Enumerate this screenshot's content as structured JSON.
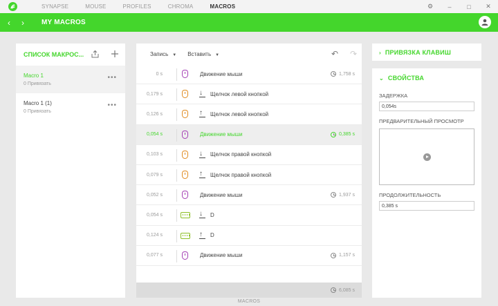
{
  "topbar": {
    "tabs": [
      "SYNAPSE",
      "MOUSE",
      "PROFILES",
      "CHROMA",
      "MACROS"
    ],
    "active_tab": 4,
    "window_controls": {
      "settings": "⚙",
      "minimize": "–",
      "maximize": "□",
      "close": "✕"
    }
  },
  "header": {
    "title": "MY MACROS",
    "back": "‹",
    "forward": "›"
  },
  "macro_list": {
    "title": "СПИСОК МАКРОС...",
    "items": [
      {
        "name": "Macro 1",
        "sub": "0 Привязать",
        "more": "•••",
        "selected": true
      },
      {
        "name": "Macro 1 (1)",
        "sub": "0 Привязать",
        "more": "•••",
        "selected": false
      }
    ]
  },
  "editor": {
    "record_label": "Запись",
    "insert_label": "Вставить",
    "undo": "↶",
    "redo": "↷",
    "rows": [
      {
        "delay": "0 s",
        "type": "move",
        "label": "Движение мыши",
        "duration": "1,758 s"
      },
      {
        "delay": "0,179 s",
        "type": "click",
        "dir": "down",
        "label": "Щелчок левой кнопкой",
        "duration": ""
      },
      {
        "delay": "0,126 s",
        "type": "click",
        "dir": "up",
        "label": "Щелчок левой кнопкой",
        "duration": ""
      },
      {
        "delay": "0,054 s",
        "type": "move",
        "label": "Движение мыши",
        "duration": "0,385 s",
        "selected": true
      },
      {
        "delay": "0,103 s",
        "type": "click",
        "dir": "down",
        "label": "Щелчок правой кнопкой",
        "duration": ""
      },
      {
        "delay": "0,079 s",
        "type": "click",
        "dir": "up",
        "label": "Щелчок правой кнопкой",
        "duration": ""
      },
      {
        "delay": "0,052 s",
        "type": "move",
        "label": "Движение мыши",
        "duration": "1,937 s"
      },
      {
        "delay": "0,054 s",
        "type": "key",
        "dir": "down",
        "label": "D",
        "duration": ""
      },
      {
        "delay": "0,124 s",
        "type": "key",
        "dir": "up",
        "label": "D",
        "duration": ""
      },
      {
        "delay": "0,077 s",
        "type": "move",
        "label": "Движение мыши",
        "duration": "1,157 s"
      }
    ],
    "total": "6,085 s"
  },
  "right": {
    "binding_title": "ПРИВЯЗКА КЛАВИШ",
    "properties_title": "СВОЙСТВА",
    "delay_label": "ЗАДЕРЖКА",
    "delay_value": "0,054s",
    "preview_label": "ПРЕДВАРИТЕЛЬНЫЙ ПРОСМОТР",
    "duration_label": "ПРОДОЛЖИТЕЛЬНОСТЬ",
    "duration_value": "0,385 s"
  },
  "footer": {
    "label": "MACROS"
  },
  "colors": {
    "accent": "#44d62c",
    "move_icon": "#a33db3",
    "click_icon": "#e08a1e",
    "key_icon": "#8dbf25"
  }
}
